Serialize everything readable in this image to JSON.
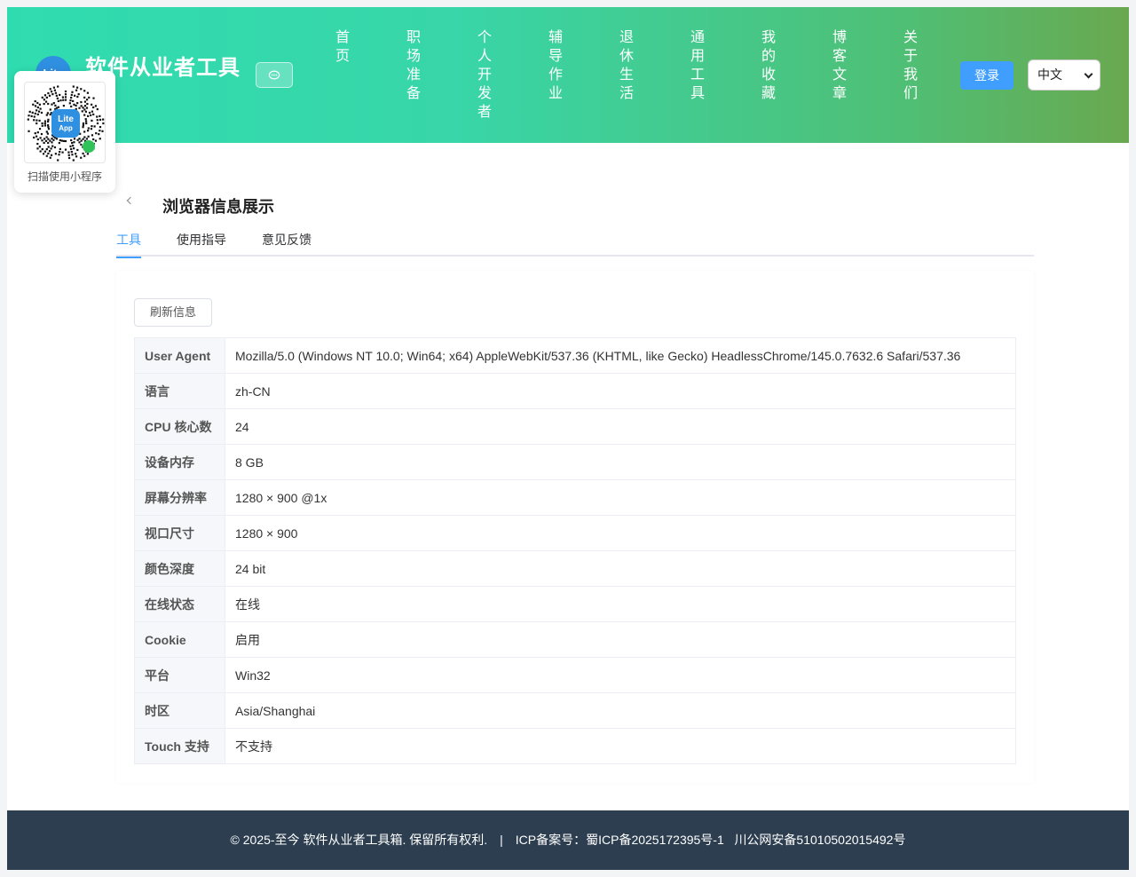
{
  "header": {
    "logo_text": "Lite",
    "site_title": "软件从业者工具",
    "nav": [
      "首页",
      "职场准备",
      "个人开发者",
      "辅导作业",
      "退休生活",
      "通用工具",
      "我的收藏",
      "博客文章",
      "关于我们"
    ],
    "login_label": "登录",
    "language": "中文"
  },
  "qr": {
    "badge_line1": "Lite",
    "badge_line2": "App",
    "caption": "扫描使用小程序"
  },
  "page": {
    "title": "浏览器信息展示",
    "tabs": [
      "工具",
      "使用指导",
      "意见反馈"
    ],
    "refresh_label": "刷新信息"
  },
  "info": [
    {
      "key": "User Agent",
      "value": "Mozilla/5.0 (Windows NT 10.0; Win64; x64) AppleWebKit/537.36 (KHTML, like Gecko) HeadlessChrome/145.0.7632.6 Safari/537.36"
    },
    {
      "key": "语言",
      "value": "zh-CN"
    },
    {
      "key": "CPU 核心数",
      "value": "24"
    },
    {
      "key": "设备内存",
      "value": "8 GB"
    },
    {
      "key": "屏幕分辨率",
      "value": "1280 × 900 @1x"
    },
    {
      "key": "视口尺寸",
      "value": "1280 × 900"
    },
    {
      "key": "颜色深度",
      "value": "24 bit"
    },
    {
      "key": "在线状态",
      "value": "在线"
    },
    {
      "key": "Cookie",
      "value": "启用"
    },
    {
      "key": "平台",
      "value": "Win32"
    },
    {
      "key": "时区",
      "value": "Asia/Shanghai"
    },
    {
      "key": "Touch 支持",
      "value": "不支持"
    }
  ],
  "footer": {
    "copyright": "© 2025-至今 软件从业者工具箱. 保留所有权利.",
    "separator": "|",
    "icp": "ICP备案号：蜀ICP备2025172395号-1",
    "police": "川公网安备51010502015492号"
  },
  "colors": {
    "accent": "#409eff",
    "footer_bg": "#2c3e50",
    "header_start": "#2fdcb0",
    "header_end": "#6aa84f"
  }
}
